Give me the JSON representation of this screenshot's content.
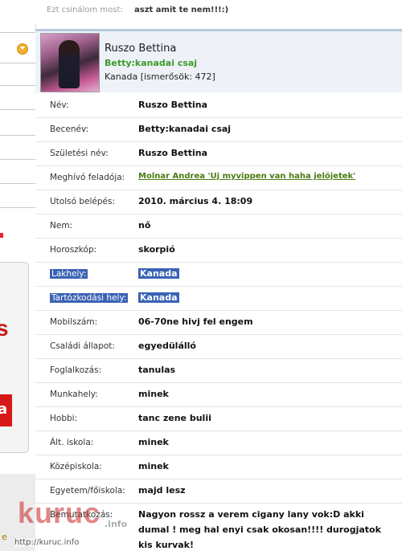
{
  "status": {
    "label": "Ezt csinálom most:",
    "value": "aszt amit te nem!!!:)"
  },
  "profile_card": {
    "name": "Ruszo Bettina",
    "nickname": "Betty:kanadai csaj",
    "location_friends": "Kanada [ismerősök: 472]"
  },
  "fields": [
    {
      "label": "Név:",
      "value": "Ruszo Bettina"
    },
    {
      "label": "Becenév:",
      "value": "Betty:kanadai csaj"
    },
    {
      "label": "Születési név:",
      "value": "Ruszo Bettina"
    },
    {
      "label": "Meghívó feladója:",
      "value": "Molnar Andrea 'Uj myvippen van haha jelöjetek'"
    },
    {
      "label": "Utolsó belépés:",
      "value": "2010. március 4. 18:09"
    },
    {
      "label": "Nem:",
      "value": "nő"
    },
    {
      "label": "Horoszkóp:",
      "value": "skorpió"
    },
    {
      "label": "Lakhely:",
      "value": "Kanada"
    },
    {
      "label": "Tartózkodási hely:",
      "value": "Kanada"
    },
    {
      "label": "Mobilszám:",
      "value": "06-70ne hivj fel engem"
    },
    {
      "label": "Családi állapot:",
      "value": "egyedülálló"
    },
    {
      "label": "Foglalkozás:",
      "value": "tanulas"
    },
    {
      "label": "Munkahely:",
      "value": "minek"
    },
    {
      "label": "Hobbi:",
      "value": "tanc zene bulii"
    },
    {
      "label": "Ált. iskola:",
      "value": "minek"
    },
    {
      "label": "Középiskola:",
      "value": "minek"
    },
    {
      "label": "Egyetem/főiskola:",
      "value": "majd lesz"
    },
    {
      "label": "Bemutatkozás:",
      "value": "Nagyon rossz a verem cigany lany vok:D akki dumal ! meg hal enyi csak okosan!!!! durogjatok kis kurvak!"
    }
  ],
  "watermark": {
    "brand": "kuruc",
    "suffix": ".info",
    "url": "http://kuruc.info"
  },
  "colors": {
    "highlight": "#3a62b4",
    "link_green": "#4a7a10",
    "nick_green": "#3a9a2a",
    "card_bg": "#eef2f8"
  }
}
